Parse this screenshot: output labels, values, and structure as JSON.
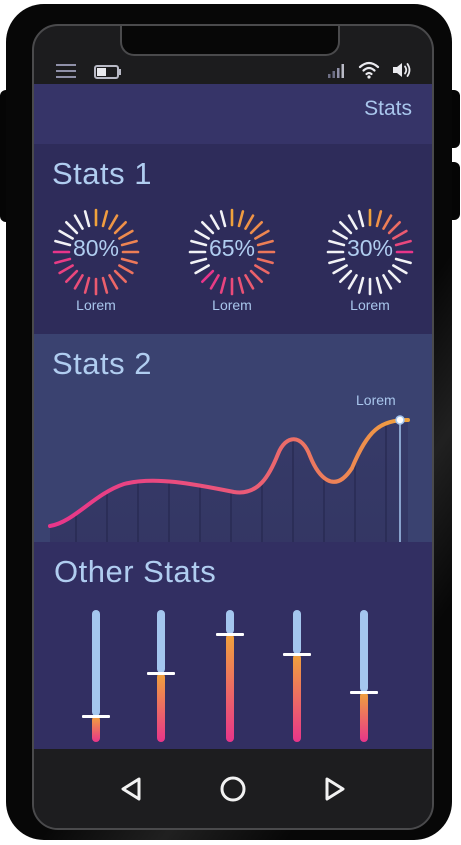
{
  "header": {
    "title": "Stats"
  },
  "status_bar": {
    "icons": [
      "menu-icon",
      "battery-icon",
      "signal-icon",
      "wifi-icon",
      "volume-icon"
    ]
  },
  "stats1": {
    "title": "Stats 1",
    "gauges": [
      {
        "value": "80%",
        "label": "Lorem",
        "percent": 80
      },
      {
        "value": "65%",
        "label": "Lorem",
        "percent": 65
      },
      {
        "value": "30%",
        "label": "Lorem",
        "percent": 30
      }
    ]
  },
  "stats2": {
    "title": "Stats 2",
    "marker_label": "Lorem"
  },
  "other_stats": {
    "title": "Other Stats",
    "sliders": [
      {
        "level": 0.2
      },
      {
        "level": 0.52
      },
      {
        "level": 0.82
      },
      {
        "level": 0.67
      },
      {
        "level": 0.38
      }
    ]
  },
  "nav": {
    "icons": [
      "back-triangle-icon",
      "home-circle-icon",
      "recents-triangle-icon"
    ]
  },
  "colors": {
    "gradient_start": "#e8358a",
    "gradient_end": "#f0a33c",
    "accent_text": "#b0cdf0",
    "slider_track": "#a4c6ee"
  }
}
